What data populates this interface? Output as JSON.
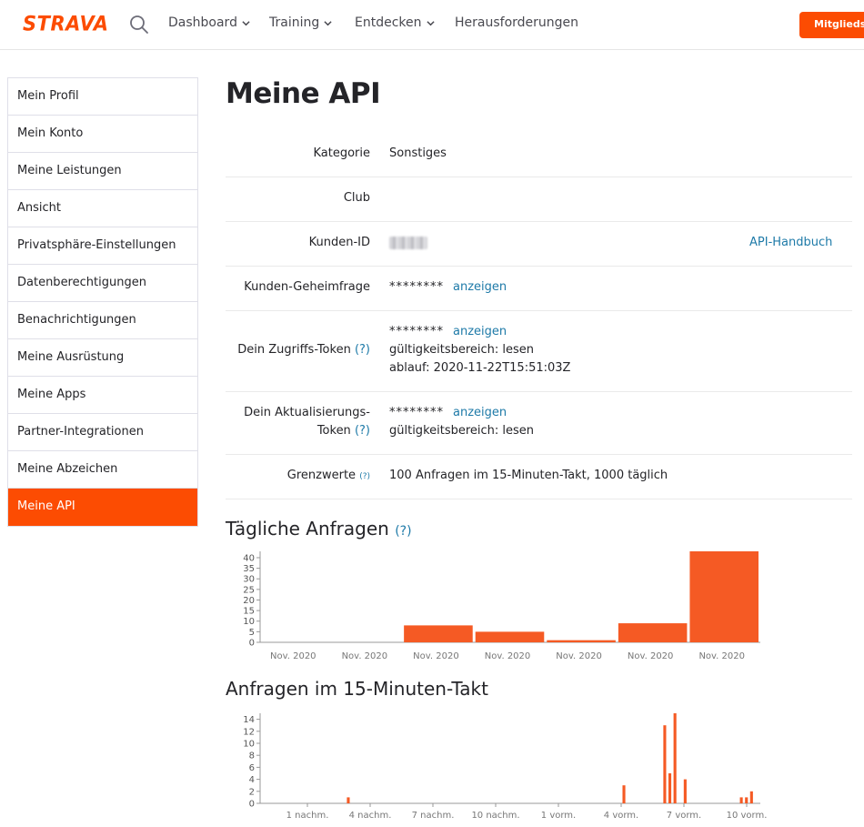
{
  "nav": {
    "logo": "STRAVA",
    "items": [
      "Dashboard",
      "Training",
      "Entdecken",
      "Herausforderungen"
    ],
    "member_button": "Mitgliedschaft"
  },
  "sidebar": {
    "items": [
      {
        "label": "Mein Profil",
        "active": false
      },
      {
        "label": "Mein Konto",
        "active": false
      },
      {
        "label": "Meine Leistungen",
        "active": false
      },
      {
        "label": "Ansicht",
        "active": false
      },
      {
        "label": "Privatsphäre-Einstellungen",
        "active": false
      },
      {
        "label": "Datenberechtigungen",
        "active": false
      },
      {
        "label": "Benachrichtigungen",
        "active": false
      },
      {
        "label": "Meine Ausrüstung",
        "active": false
      },
      {
        "label": "Meine Apps",
        "active": false
      },
      {
        "label": "Partner-Integrationen",
        "active": false
      },
      {
        "label": "Meine Abzeichen",
        "active": false
      },
      {
        "label": "Meine API",
        "active": true
      }
    ]
  },
  "main": {
    "title": "Meine API",
    "kategorie_label": "Kategorie",
    "kategorie_value": "Sonstiges",
    "club_label": "Club",
    "kunden_id_label": "Kunden-ID",
    "api_handbuch": "API-Handbuch",
    "secret_label": "Kunden-Geheimfrage",
    "masked": "********",
    "show_link": "anzeigen",
    "access_token_label": "Dein Zugriffs-Token",
    "help_mark": "(?)",
    "scope_line": "gültigkeitsbereich: lesen",
    "expiry_line": "ablauf: 2020-11-22T15:51:03Z",
    "refresh_label_1": "Dein Aktualisierungs-",
    "refresh_label_2": "Token",
    "limits_label": "Grenzwerte",
    "limits_value": "100 Anfragen im 15-Minuten-Takt, 1000 täglich",
    "daily_title": "Tägliche Anfragen",
    "quarter_title": "Anfragen im 15-Minuten-Takt"
  },
  "chart_data": [
    {
      "type": "bar",
      "categories": [
        "Nov. 2020",
        "Nov. 2020",
        "Nov. 2020",
        "Nov. 2020",
        "Nov. 2020",
        "Nov. 2020",
        "Nov. 2020"
      ],
      "values": [
        0,
        0,
        8,
        5,
        1,
        9,
        43
      ],
      "ylim": [
        0,
        43
      ],
      "yticks": [
        0,
        5,
        10,
        15,
        20,
        25,
        30,
        35,
        40
      ],
      "color": "#f55a24",
      "grid": false
    },
    {
      "type": "bar",
      "xticks": [
        "1 nachm.",
        "4 nachm.",
        "7 nachm.",
        "10 nachm.",
        "1 vorm.",
        "4 vorm.",
        "7 vorm.",
        "10 vorm."
      ],
      "yticks": [
        0,
        2,
        4,
        6,
        8,
        10,
        12,
        14
      ],
      "ylim": [
        0,
        15
      ],
      "bars": [
        {
          "slot": 17,
          "value": 1
        },
        {
          "slot": 71,
          "value": 3
        },
        {
          "slot": 79,
          "value": 13
        },
        {
          "slot": 80,
          "value": 5
        },
        {
          "slot": 81,
          "value": 15
        },
        {
          "slot": 83,
          "value": 4
        },
        {
          "slot": 94,
          "value": 1
        },
        {
          "slot": 95,
          "value": 1
        },
        {
          "slot": 96,
          "value": 2
        }
      ],
      "color": "#f55a24",
      "grid": false
    }
  ]
}
